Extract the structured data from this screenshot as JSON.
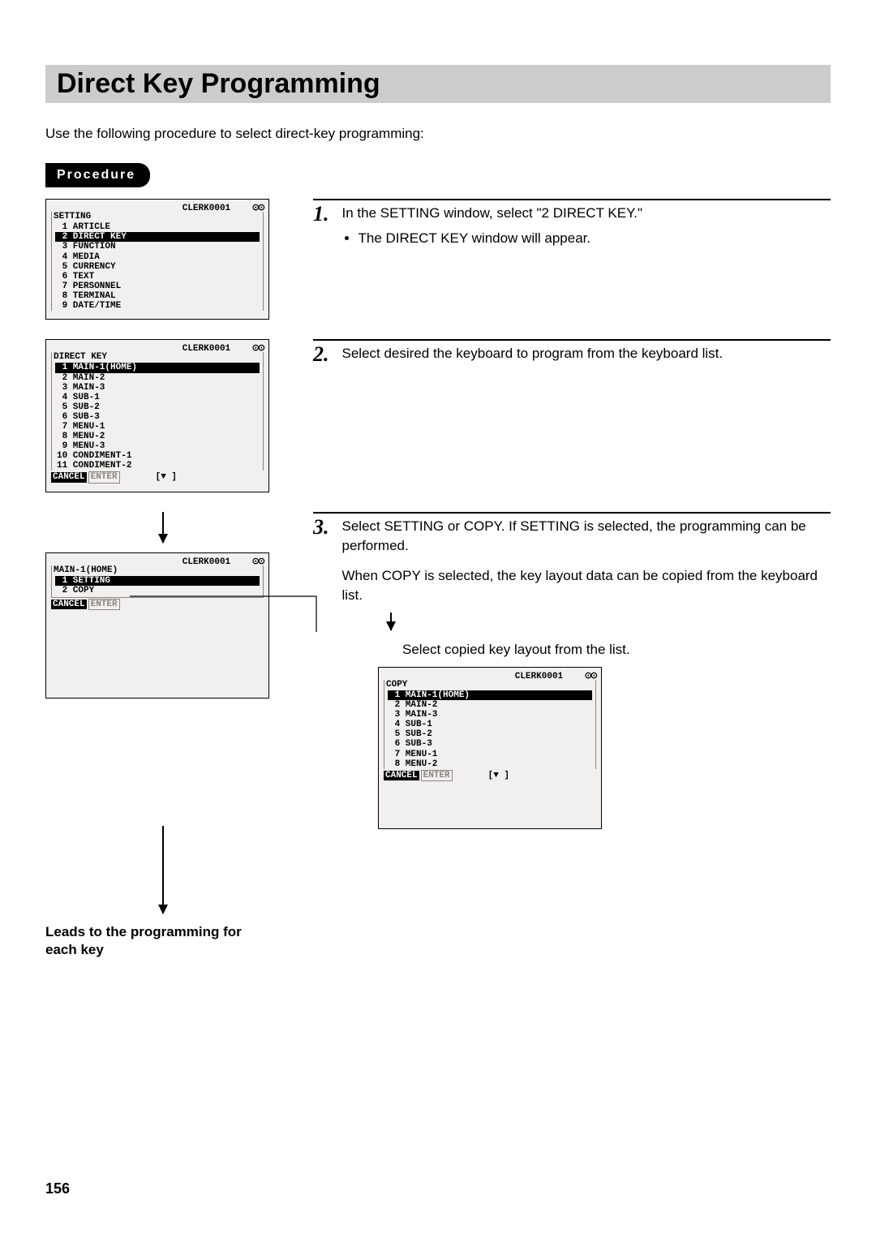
{
  "title": "Direct Key Programming",
  "intro": "Use the following procedure to select direct-key programming:",
  "procedure_label": "Procedure",
  "clerk_label": "CLERK0001",
  "status_icons": "⊙⊙",
  "screens": {
    "setting": {
      "group": "SETTING",
      "items": [
        " 1 ARTICLE",
        " 2 DIRECT KEY",
        " 3 FUNCTION",
        " 4 MEDIA",
        " 5 CURRENCY",
        " 6 TEXT",
        " 7 PERSONNEL",
        " 8 TERMINAL",
        " 9 DATE/TIME"
      ],
      "selected_index": 1
    },
    "directkey": {
      "group": "DIRECT KEY",
      "items": [
        " 1 MAIN-1(HOME)",
        " 2 MAIN-2",
        " 3 MAIN-3",
        " 4 SUB-1",
        " 5 SUB-2",
        " 6 SUB-3",
        " 7 MENU-1",
        " 8 MENU-2",
        " 9 MENU-3",
        "10 CONDIMENT-1",
        "11 CONDIMENT-2"
      ],
      "selected_index": 0,
      "footer_cancel": "CANCEL",
      "footer_enter": "ENTER",
      "footer_arrow": "[▼ ]"
    },
    "main1": {
      "group": "MAIN-1(HOME)",
      "items": [
        " 1 SETTING",
        " 2 COPY"
      ],
      "selected_index": 0,
      "footer_cancel": "CANCEL",
      "footer_enter": "ENTER"
    },
    "copy": {
      "group": "COPY",
      "items": [
        " 1 MAIN-1(HOME)",
        " 2 MAIN-2",
        " 3 MAIN-3",
        " 4 SUB-1",
        " 5 SUB-2",
        " 6 SUB-3",
        " 7 MENU-1",
        " 8 MENU-2"
      ],
      "selected_index": 0,
      "footer_cancel": "CANCEL",
      "footer_enter": "ENTER",
      "footer_arrow": "[▼ ]"
    }
  },
  "steps": {
    "s1": {
      "num": "1.",
      "text": "In the SETTING window, select \"2 DIRECT KEY.\"",
      "bullet": "The DIRECT KEY window will appear."
    },
    "s2": {
      "num": "2.",
      "text": "Select desired the keyboard to program from the keyboard list."
    },
    "s3": {
      "num": "3.",
      "text": "Select SETTING or COPY. If SETTING is selected, the programming can be performed.",
      "para2": "When COPY is selected, the key layout data can be copied from the keyboard list.",
      "para3": "Select copied key layout from the list."
    }
  },
  "leads": "Leads to the programming for each key",
  "page_number": "156"
}
